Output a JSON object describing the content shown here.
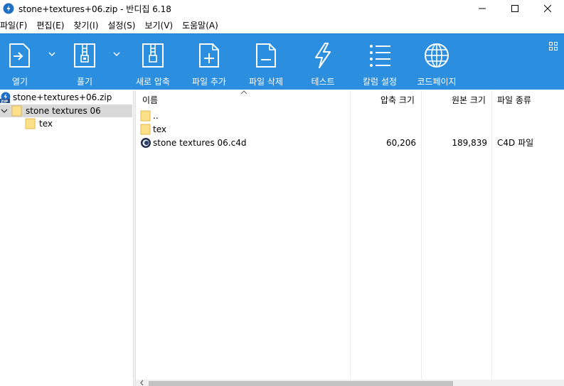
{
  "window": {
    "title": "stone+textures+06.zip - 반디집 6.18"
  },
  "menu": {
    "items": [
      "파일(F)",
      "편집(E)",
      "찾기(I)",
      "설정(S)",
      "보기(V)",
      "도움말(A)"
    ]
  },
  "toolbar": {
    "open_label": "열기",
    "extract_label": "풀기",
    "new_archive_label": "새로 압축",
    "add_files_label": "파일 추가",
    "delete_files_label": "파일 삭제",
    "test_label": "테스트",
    "columns_label": "칼럼 설정",
    "codepage_label": "코드페이지",
    "accent": "#2b8ede"
  },
  "tree": {
    "archive": "stone+textures+06.zip",
    "folder": "stone textures 06",
    "subfolder": "tex"
  },
  "list": {
    "columns": {
      "name": "이름",
      "compressed": "압축 크기",
      "original": "원본 크기",
      "type": "파일 종류"
    },
    "rows": [
      {
        "name": "..",
        "compressed": "",
        "original": "",
        "type": "",
        "icon": "folder-icon"
      },
      {
        "name": "tex",
        "compressed": "",
        "original": "",
        "type": "",
        "icon": "folder-icon"
      },
      {
        "name": "stone textures 06.c4d",
        "compressed": "60,206",
        "original": "189,839",
        "type": "C4D 파일",
        "icon": "c4d-file-icon"
      }
    ]
  }
}
